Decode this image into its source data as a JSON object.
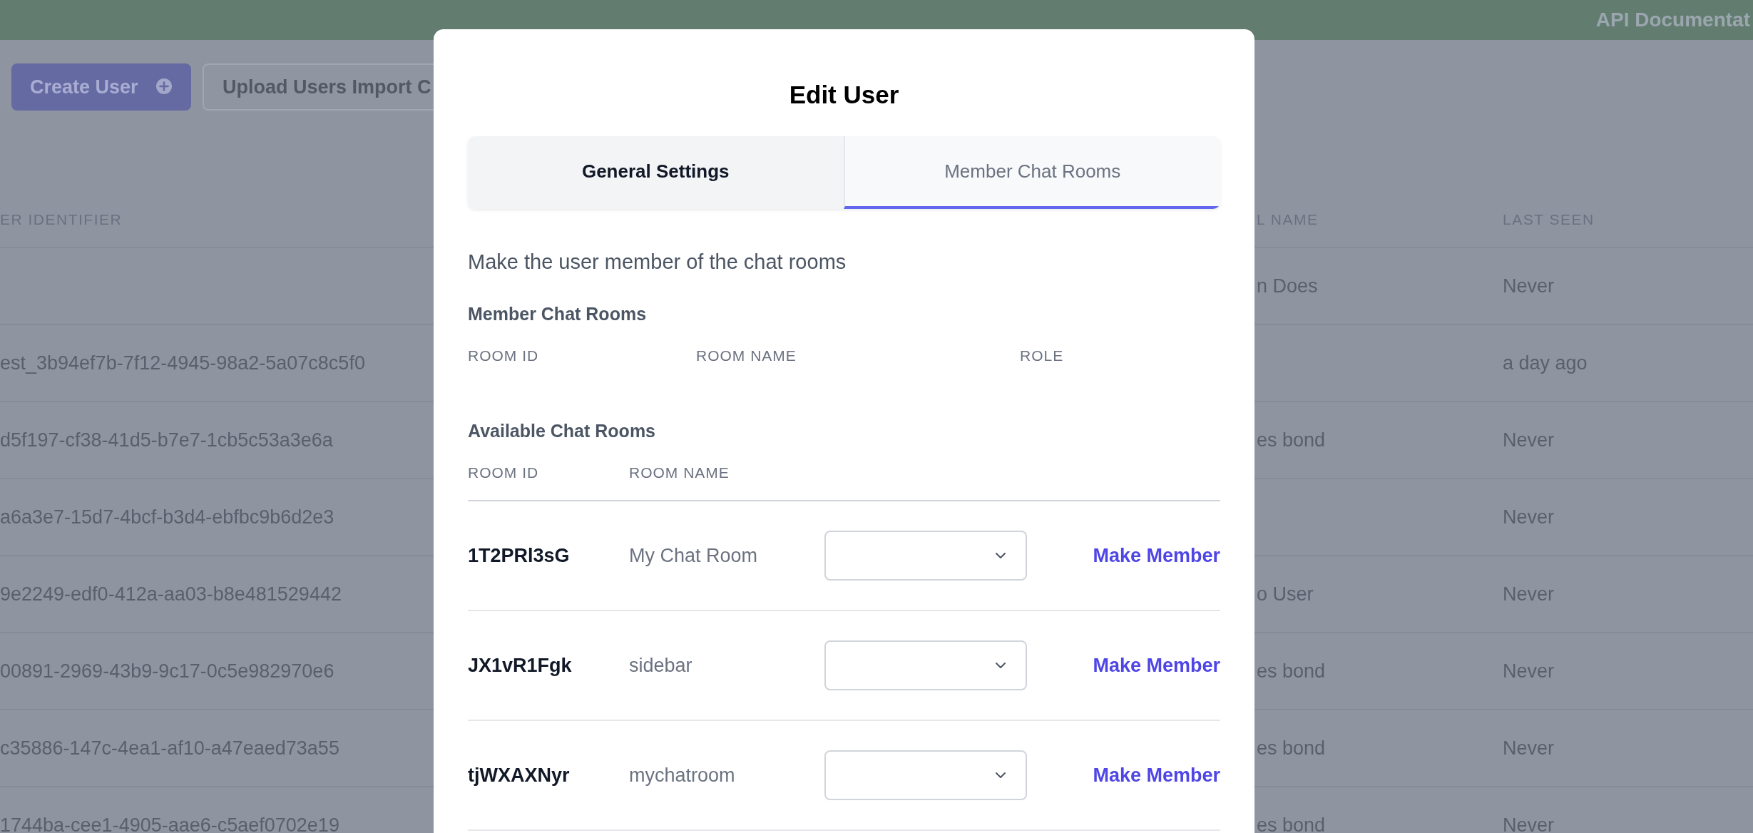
{
  "header": {
    "title": "API Documentat"
  },
  "toolbar": {
    "buttons": [
      {
        "label": "Create User",
        "kind": "primary"
      },
      {
        "label": "Upload Users Import C",
        "kind": "secondary"
      }
    ]
  },
  "users_table": {
    "columns": [
      "ER IDENTIFIER",
      "L NAME",
      "LAST SEEN"
    ],
    "rows": [
      {
        "name": "n Does",
        "last_seen": "Never"
      },
      {
        "identifier": "est_3b94ef7b-7f12-4945-98a2-5a07c8c5f0",
        "last_seen": "a day ago"
      },
      {
        "identifier": "d5f197-cf38-41d5-b7e7-1cb5c53a3e6a",
        "name": "es bond",
        "last_seen": "Never"
      },
      {
        "identifier": "a6a3e7-15d7-4bcf-b3d4-ebfbc9b6d2e3",
        "last_seen": "Never"
      },
      {
        "identifier": "9e2249-edf0-412a-aa03-b8e481529442",
        "name": "o User",
        "last_seen": "Never"
      },
      {
        "identifier": "00891-2969-43b9-9c17-0c5e982970e6",
        "name": "es bond",
        "last_seen": "Never"
      },
      {
        "identifier": "c35886-147c-4ea1-af10-a47eaed73a55",
        "name": "es bond",
        "last_seen": "Never"
      },
      {
        "identifier": "1744ba-cee1-4905-aae6-c5aef0702e19",
        "name": "es bond",
        "last_seen": "Never"
      }
    ]
  },
  "modal": {
    "title": "Edit User",
    "tabs": [
      {
        "label": "General Settings",
        "selected": false
      },
      {
        "label": "Member Chat Rooms",
        "selected": true
      }
    ],
    "description": "Make the user member of the chat rooms",
    "member_rooms": {
      "heading": "Member Chat Rooms",
      "columns": [
        "ROOM ID",
        "ROOM NAME",
        "ROLE"
      ]
    },
    "available_rooms": {
      "heading": "Available Chat Rooms",
      "columns": [
        "ROOM ID",
        "ROOM NAME"
      ],
      "rows": [
        {
          "room_id": "1T2PRl3sG",
          "room_name": "My Chat Room",
          "action": "Make Member"
        },
        {
          "room_id": "JX1vR1Fgk",
          "room_name": "sidebar",
          "action": "Make Member"
        },
        {
          "room_id": "tjWXAXNyr",
          "room_name": "mychatroom",
          "action": "Make Member"
        }
      ]
    }
  }
}
